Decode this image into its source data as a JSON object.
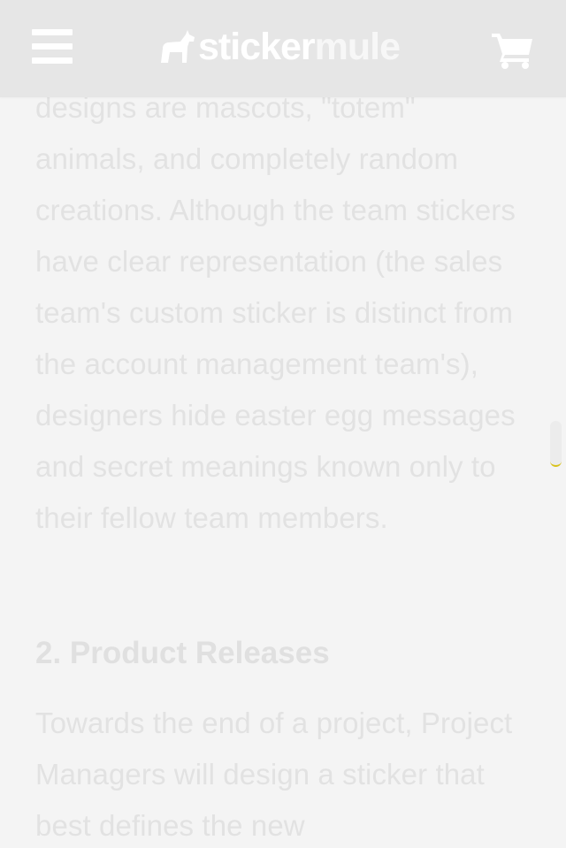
{
  "header": {
    "logo_word_1": "sticker",
    "logo_word_2": "mule",
    "icons": {
      "menu": "hamburger-menu-icon",
      "logo": "mule-icon",
      "cart": "shopping-cart-icon"
    }
  },
  "article": {
    "paragraph_1": "designs are mascots, \"totem\" animals, and completely random creations. Although the team stickers have clear representation (the sales team's custom sticker is distinct from the account management team's), designers hide easter egg messages and secret meanings known only to their fellow team members.",
    "heading_2": "2. Product Releases",
    "paragraph_2": "Towards the end of a project, Project Managers will design a sticker that best defines the new"
  },
  "colors": {
    "header_bg": "#e6e6e6",
    "page_bg": "#f4f4f4",
    "text": "#e2e2e2",
    "scroll_accent": "#d8c21a"
  }
}
